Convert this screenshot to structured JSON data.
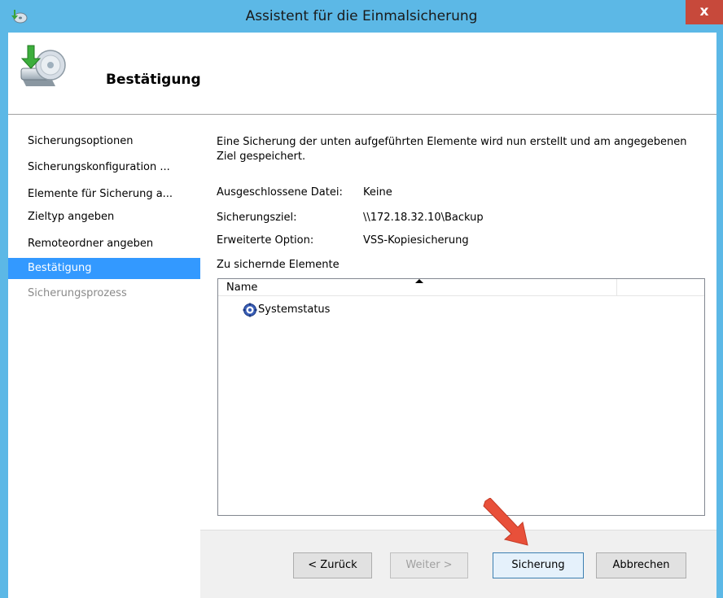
{
  "window": {
    "title": "Assistent für die Einmalsicherung",
    "close_label": "x",
    "titlebar_color": "#5cb8e6"
  },
  "header": {
    "title": "Bestätigung",
    "icon": "backup-disk-icon"
  },
  "sidebar": {
    "items": [
      {
        "label": "Sicherungsoptionen",
        "state": "normal"
      },
      {
        "label": "Sicherungskonfiguration ...",
        "state": "normal"
      },
      {
        "label": "Elemente für Sicherung a...",
        "state": "normal"
      },
      {
        "label": "Zieltyp angeben",
        "state": "normal"
      },
      {
        "label": "Remoteordner angeben",
        "state": "normal"
      },
      {
        "label": "Bestätigung",
        "state": "selected"
      },
      {
        "label": "Sicherungsprozess",
        "state": "disabled"
      }
    ],
    "selected_color": "#3399ff"
  },
  "main": {
    "intro": "Eine Sicherung der unten aufgeführten Elemente wird nun erstellt und am angegebenen Ziel gespeichert.",
    "details": [
      {
        "label": "Ausgeschlossene Datei:",
        "value": "Keine"
      },
      {
        "label": "Sicherungsziel:",
        "value": "\\\\172.18.32.10\\Backup"
      },
      {
        "label": "Erweiterte Option:",
        "value": "VSS-Kopiesicherung"
      }
    ],
    "items_label": "Zu sichernde Elemente",
    "list": {
      "column_name": "Name",
      "rows": [
        {
          "label": "Systemstatus",
          "icon": "system-state-icon"
        }
      ]
    }
  },
  "buttons": {
    "back": "< Zurück",
    "next": "Weiter >",
    "backup": "Sicherung",
    "cancel": "Abbrechen"
  },
  "annotation": {
    "arrow_color": "#e8503a"
  }
}
